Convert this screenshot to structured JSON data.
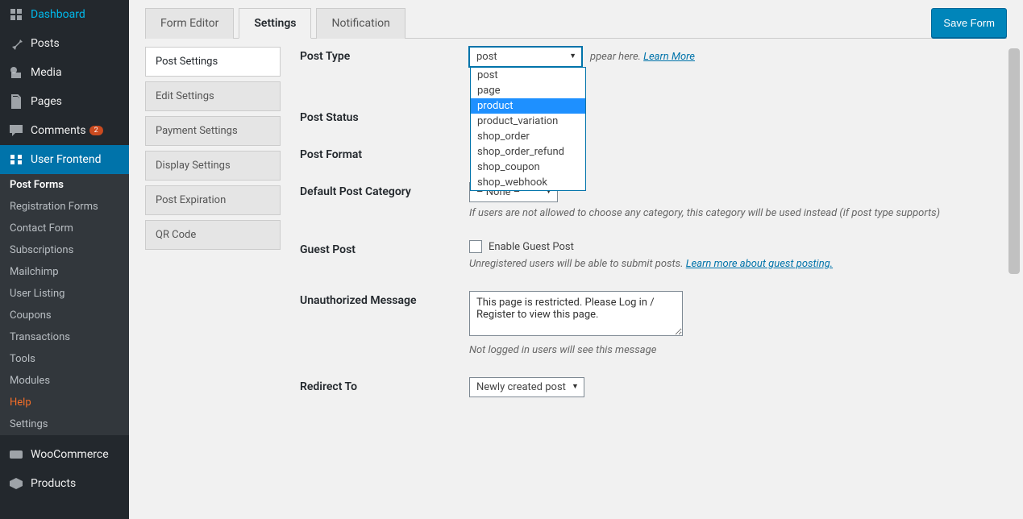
{
  "sidebar": {
    "items": [
      {
        "label": "Dashboard",
        "icon": "dashboard"
      },
      {
        "label": "Posts",
        "icon": "pin"
      },
      {
        "label": "Media",
        "icon": "media"
      },
      {
        "label": "Pages",
        "icon": "pages"
      },
      {
        "label": "Comments",
        "icon": "comment",
        "badge": "2"
      },
      {
        "label": "User Frontend",
        "icon": "frontend",
        "current": true
      },
      {
        "label": "WooCommerce",
        "icon": "woo"
      },
      {
        "label": "Products",
        "icon": "products"
      }
    ],
    "uf_sub": [
      {
        "label": "Post Forms",
        "active": true
      },
      {
        "label": "Registration Forms"
      },
      {
        "label": "Contact Form"
      },
      {
        "label": "Subscriptions"
      },
      {
        "label": "Mailchimp"
      },
      {
        "label": "User Listing"
      },
      {
        "label": "Coupons"
      },
      {
        "label": "Transactions"
      },
      {
        "label": "Tools"
      },
      {
        "label": "Modules"
      },
      {
        "label": "Help",
        "highlight": true
      },
      {
        "label": "Settings"
      }
    ]
  },
  "tabs": [
    {
      "label": "Form Editor"
    },
    {
      "label": "Settings",
      "active": true
    },
    {
      "label": "Notification"
    }
  ],
  "save_label": "Save Form",
  "settings_nav": [
    {
      "label": "Post Settings",
      "active": true
    },
    {
      "label": "Edit Settings"
    },
    {
      "label": "Payment Settings"
    },
    {
      "label": "Display Settings"
    },
    {
      "label": "Post Expiration"
    },
    {
      "label": "QR Code"
    }
  ],
  "form": {
    "post_type": {
      "label": "Post Type",
      "value": "post",
      "options": [
        "post",
        "page",
        "product",
        "product_variation",
        "shop_order",
        "shop_order_refund",
        "shop_coupon",
        "shop_webhook"
      ],
      "highlighted": "product",
      "help_suffix": "ppear here.",
      "learn_more": "Learn More"
    },
    "post_status": {
      "label": "Post Status"
    },
    "post_format": {
      "label": "Post Format"
    },
    "default_category": {
      "label": "Default Post Category",
      "value": "– None –",
      "help": "If users are not allowed to choose any category, this category will be used instead (if post type supports)"
    },
    "guest_post": {
      "label": "Guest Post",
      "checkbox_label": "Enable Guest Post",
      "help_prefix": "Unregistered users will be able to submit posts.",
      "learn_more": "Learn more about guest posting."
    },
    "unauthorized": {
      "label": "Unauthorized Message",
      "value": "This page is restricted. Please Log in / Register to view this page.",
      "help": "Not logged in users will see this message"
    },
    "redirect": {
      "label": "Redirect To",
      "value": "Newly created post"
    }
  }
}
